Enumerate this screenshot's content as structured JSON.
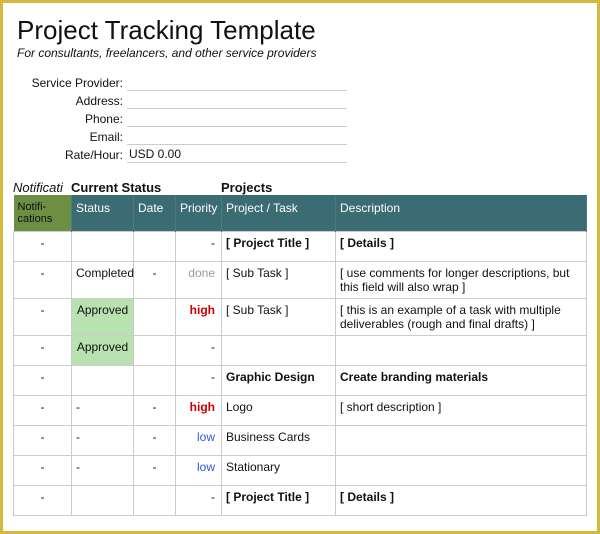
{
  "header": {
    "title": "Project Tracking Template",
    "subtitle": "For consultants, freelancers, and other service providers"
  },
  "info": {
    "labels": {
      "provider": "Service Provider:",
      "address": "Address:",
      "phone": "Phone:",
      "email": "Email:",
      "rate": "Rate/Hour:"
    },
    "values": {
      "provider": "",
      "address": "",
      "phone": "",
      "email": "",
      "rate": "USD 0.00"
    }
  },
  "sections": {
    "notifications": "Notificati",
    "current_status": "Current Status",
    "projects": "Projects"
  },
  "columns": {
    "notifications": "Notifi-cations",
    "status": "Status",
    "date": "Date",
    "priority": "Priority",
    "project_task": "Project / Task",
    "description": "Description"
  },
  "rows": [
    {
      "notif": "-",
      "status": "",
      "date": "",
      "prio": "-",
      "prio_class": "",
      "task": "[ Project Title ]",
      "task_bold": true,
      "desc": "[ Details ]",
      "desc_bold": true,
      "status_class": ""
    },
    {
      "notif": "-",
      "status": "Completed",
      "date": "-",
      "prio": "done",
      "prio_class": "prio-done",
      "task": "[ Sub Task ]",
      "task_bold": false,
      "desc": "[ use comments for longer descriptions, but this field will also wrap ]",
      "desc_bold": false,
      "status_class": ""
    },
    {
      "notif": "-",
      "status": "Approved",
      "date": "",
      "prio": "high",
      "prio_class": "prio-high",
      "task": "[ Sub Task ]",
      "task_bold": false,
      "desc": "[ this is an example of a task with multiple deliverables (rough and final drafts) ]",
      "desc_bold": false,
      "status_class": "approved"
    },
    {
      "notif": "-",
      "status": "Approved",
      "date": "",
      "prio": "-",
      "prio_class": "",
      "task": "",
      "task_bold": false,
      "desc": "",
      "desc_bold": false,
      "status_class": "approved"
    },
    {
      "notif": "-",
      "status": "",
      "date": "",
      "prio": "-",
      "prio_class": "",
      "task": "Graphic Design",
      "task_bold": true,
      "desc": "Create branding materials",
      "desc_bold": true,
      "status_class": ""
    },
    {
      "notif": "-",
      "status": "-",
      "date": "-",
      "prio": "high",
      "prio_class": "prio-high",
      "task": "Logo",
      "task_bold": false,
      "desc": "[ short description ]",
      "desc_bold": false,
      "status_class": ""
    },
    {
      "notif": "-",
      "status": "-",
      "date": "-",
      "prio": "low",
      "prio_class": "prio-low",
      "task": "Business Cards",
      "task_bold": false,
      "desc": "",
      "desc_bold": false,
      "status_class": ""
    },
    {
      "notif": "-",
      "status": "-",
      "date": "-",
      "prio": "low",
      "prio_class": "prio-low",
      "task": "Stationary",
      "task_bold": false,
      "desc": "",
      "desc_bold": false,
      "status_class": ""
    },
    {
      "notif": "-",
      "status": "",
      "date": "",
      "prio": "-",
      "prio_class": "",
      "task": "[ Project Title ]",
      "task_bold": true,
      "desc": "[ Details ]",
      "desc_bold": true,
      "status_class": ""
    }
  ]
}
